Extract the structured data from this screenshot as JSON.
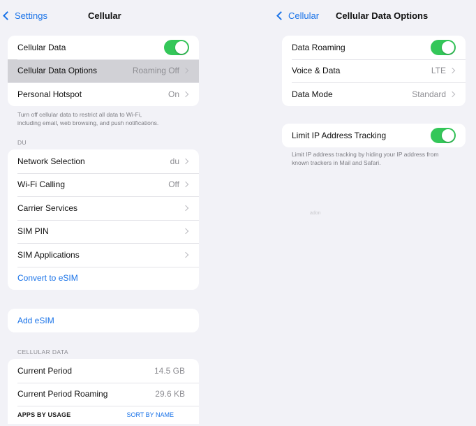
{
  "left": {
    "nav": {
      "back_label": "Settings",
      "title": "Cellular"
    },
    "group1": {
      "cellular_data_label": "Cellular Data",
      "cellular_data_options_label": "Cellular Data Options",
      "cellular_data_options_value": "Roaming Off",
      "personal_hotspot_label": "Personal Hotspot",
      "personal_hotspot_value": "On"
    },
    "footer1_line1": "Turn off cellular data to restrict all data to Wi-Fi,",
    "footer1_line2": "including email, web browsing, and push notifications.",
    "carrier_header": "DU",
    "group2": {
      "network_selection_label": "Network Selection",
      "network_selection_value": "du",
      "wifi_calling_label": "Wi-Fi Calling",
      "wifi_calling_value": "Off",
      "carrier_services_label": "Carrier Services",
      "sim_pin_label": "SIM PIN",
      "sim_applications_label": "SIM Applications",
      "convert_esim_label": "Convert to eSIM"
    },
    "add_esim_label": "Add eSIM",
    "cellular_data_header": "CELLULAR DATA",
    "group4": {
      "current_period_label": "Current Period",
      "current_period_value": "14.5 GB",
      "current_period_roaming_label": "Current Period Roaming",
      "current_period_roaming_value": "29.6 KB",
      "apps_by_usage_label": "APPS BY USAGE",
      "sort_by_name_label": "SORT BY NAME"
    }
  },
  "right": {
    "nav": {
      "back_label": "Cellular",
      "title": "Cellular Data Options"
    },
    "group1": {
      "data_roaming_label": "Data Roaming",
      "voice_data_label": "Voice & Data",
      "voice_data_value": "LTE",
      "data_mode_label": "Data Mode",
      "data_mode_value": "Standard"
    },
    "group2": {
      "limit_ip_label": "Limit IP Address Tracking"
    },
    "footer_line1": "Limit IP address tracking by hiding your IP address from",
    "footer_line2": "known trackers in Mail and Safari.",
    "faint_text": "adon"
  },
  "colors": {
    "accent": "#1a73e8",
    "toggle_on": "#34c759",
    "background": "#f2f2f7",
    "highlight": "#d1d1d6"
  }
}
